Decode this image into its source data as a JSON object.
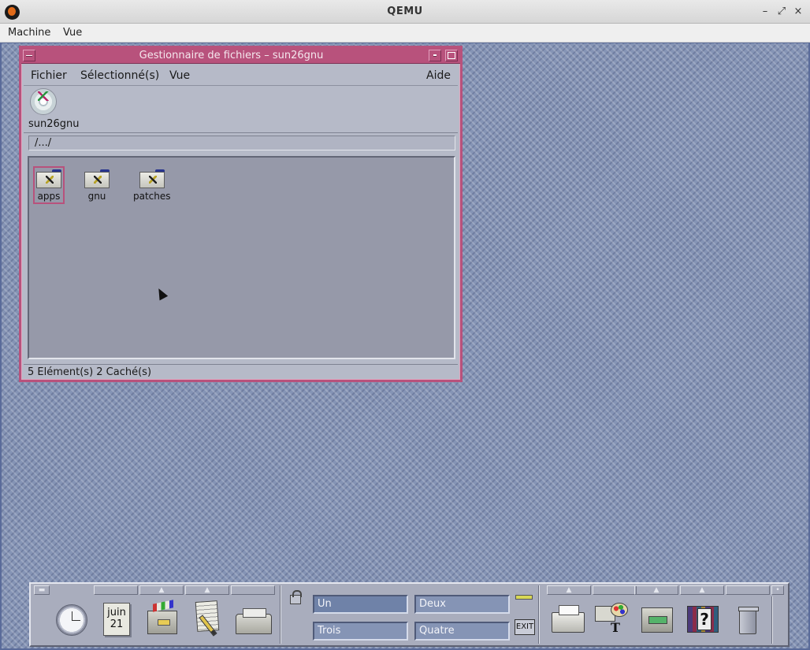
{
  "host": {
    "title": "QEMU",
    "menu": [
      "Machine",
      "Vue"
    ],
    "controls": {
      "minimize": "–",
      "restore": "⤢",
      "close": "×"
    }
  },
  "file_manager": {
    "title": "Gestionnaire de fichiers – sun26gnu",
    "menu": {
      "file": "Fichier",
      "selected": "Sélectionné(s)",
      "view": "Vue",
      "help": "Aide"
    },
    "host_icon": "cd-rom-icon",
    "host_label": "sun26gnu",
    "path": "/.../",
    "items": [
      {
        "name": "apps",
        "selected": true
      },
      {
        "name": "gnu",
        "selected": false
      },
      {
        "name": "patches",
        "selected": false
      }
    ],
    "status": "5 Elément(s) 2 Caché(s)"
  },
  "front_panel": {
    "calendar": {
      "month": "juin",
      "day": "21"
    },
    "workspaces": [
      {
        "label": "Un",
        "active": true
      },
      {
        "label": "Deux",
        "active": false
      },
      {
        "label": "Trois",
        "active": false
      },
      {
        "label": "Quatre",
        "active": false
      }
    ],
    "exit_label": "EXIT"
  },
  "colors": {
    "window_frame": "#b8527c",
    "window_bg": "#b6bac8",
    "desktop_bg": "#8594b5",
    "workspace_button": "#8594b5"
  }
}
